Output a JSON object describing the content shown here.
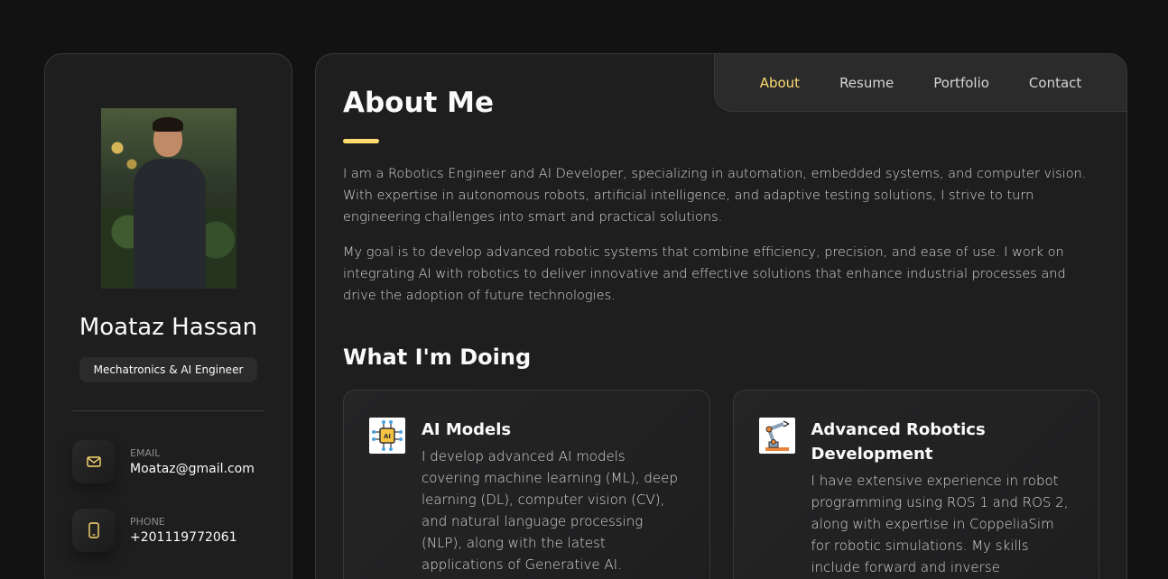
{
  "profile": {
    "name": "Moataz Hassan",
    "title": "Mechatronics & AI Engineer"
  },
  "contacts": [
    {
      "label": "EMAIL",
      "value": "Moataz@gmail.com",
      "icon": "mail-icon"
    },
    {
      "label": "PHONE",
      "value": "+201119772061",
      "icon": "phone-icon"
    }
  ],
  "nav": {
    "items": [
      "About",
      "Resume",
      "Portfolio",
      "Contact"
    ],
    "active": "About"
  },
  "about": {
    "title": "About Me",
    "paragraphs": [
      "I am a Robotics Engineer and AI Developer, specializing in automation, embedded systems, and computer vision. With expertise in autonomous robots, artificial intelligence, and adaptive testing solutions, I strive to turn engineering challenges into smart and practical solutions.",
      "My goal is to develop advanced robotic systems that combine efficiency, precision, and ease of use. I work on integrating AI with robotics to deliver innovative and effective solutions that enhance industrial processes and drive the adoption of future technologies."
    ]
  },
  "services": {
    "title": "What I'm Doing",
    "items": [
      {
        "title": "AI Models",
        "icon": "ai-chip-icon",
        "text": "I develop advanced AI models covering machine learning (ML), deep learning (DL), computer vision (CV), and natural language processing (NLP), along with the latest applications of Generative AI. Whether"
      },
      {
        "title": "Advanced Robotics Development",
        "icon": "robot-arm-icon",
        "text": "I have extensive experience in robot programming using ROS 1 and ROS 2, along with expertise in CoppeliaSim for robotic simulations. My skills include forward and inverse"
      }
    ]
  },
  "colors": {
    "accent": "#ffdb70",
    "background": "#121212",
    "card": "#1e1e1f"
  }
}
